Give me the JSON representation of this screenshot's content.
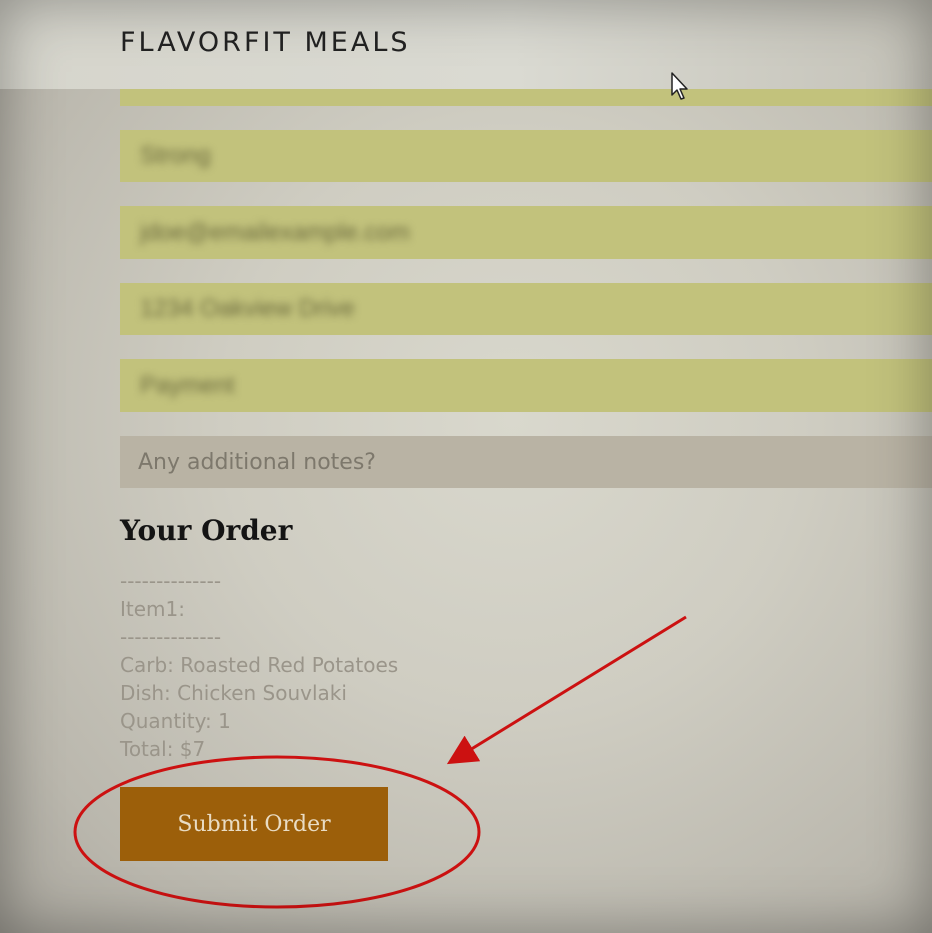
{
  "header": {
    "brand": "FLAVORFIT MEALS"
  },
  "form": {
    "fields": [
      {
        "value": "Strong"
      },
      {
        "value": "jdoe@emailexample.com"
      },
      {
        "value": "1234 Oakview Drive"
      },
      {
        "value": "Payment"
      }
    ],
    "notes_placeholder": "Any additional notes?"
  },
  "order": {
    "title": "Your Order",
    "separator": "--------------",
    "item_label": "Item1:",
    "carb": "Carb: Roasted Red Potatoes",
    "dish": "Dish: Chicken Souvlaki",
    "quantity": "Quantity: 1",
    "total": "Total: $7"
  },
  "submit": {
    "label": "Submit Order"
  },
  "colors": {
    "accent_button": "#9c5f0a",
    "field_fill": "#c2c27c",
    "annotation": "#cc1111"
  }
}
